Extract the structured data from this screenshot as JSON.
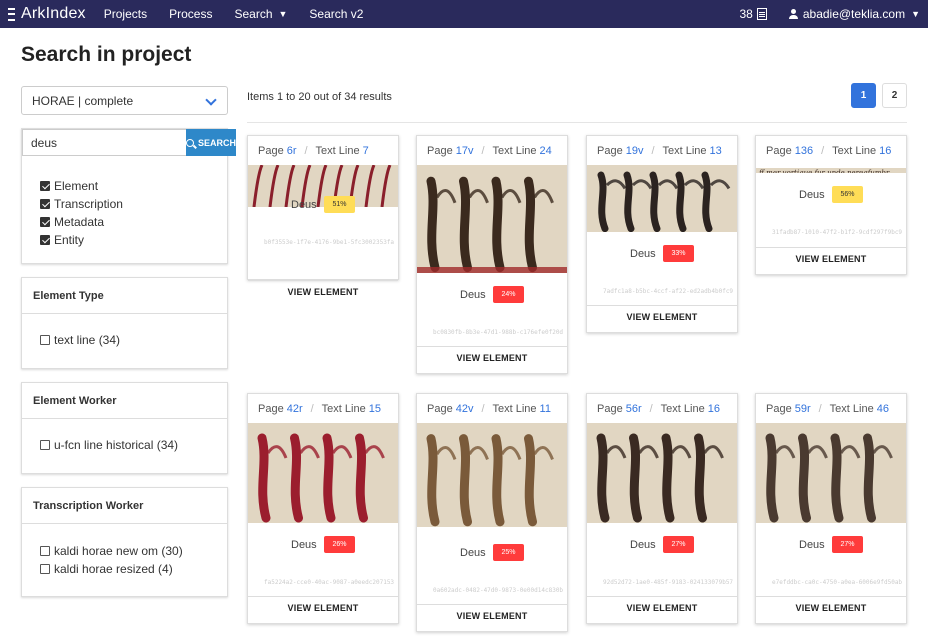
{
  "nav": {
    "logo": "ArkIndex",
    "items": [
      "Projects",
      "Process",
      "Search",
      "Search v2"
    ],
    "count": "38",
    "user": "abadie@teklia.com"
  },
  "page": {
    "title": "Search in project"
  },
  "project": {
    "selected": "HORAE | complete"
  },
  "search": {
    "query": "deus",
    "button": "SEARCH",
    "sources": [
      {
        "label": "Element",
        "checked": true
      },
      {
        "label": "Transcription",
        "checked": true
      },
      {
        "label": "Metadata",
        "checked": true
      },
      {
        "label": "Entity",
        "checked": true
      }
    ]
  },
  "facets": [
    {
      "title": "Element Type",
      "options": [
        {
          "label": "text line (34)",
          "checked": false
        }
      ]
    },
    {
      "title": "Element Worker",
      "options": [
        {
          "label": "u-fcn line historical (34)",
          "checked": false
        }
      ]
    },
    {
      "title": "Transcription Worker",
      "options": [
        {
          "label": "kaldi horae new om (30)",
          "checked": false
        },
        {
          "label": "kaldi horae resized (4)",
          "checked": false
        }
      ]
    }
  ],
  "results": {
    "summary": "Items 1 to 20 out of 34 results",
    "pages": [
      "1",
      "2"
    ],
    "active_page": "1",
    "page_prefix": "Page",
    "line_prefix": "Text Line",
    "view_label": "VIEW ELEMENT",
    "colors": {
      "high": "#ffdd57",
      "low": "#ff3b3b"
    },
    "cards": [
      {
        "page": "6r",
        "line": "7",
        "text": "Deus",
        "confidence": "51%",
        "level": "high",
        "uuid": "b0f3553e-1f7e-4176-9be1-5fc3002353fa"
      },
      {
        "page": "17v",
        "line": "24",
        "text": "Deus",
        "confidence": "24%",
        "level": "low",
        "uuid": "bc0830fb-8b3e-47d1-988b-c176efe0f20d"
      },
      {
        "page": "19v",
        "line": "13",
        "text": "Deus",
        "confidence": "33%",
        "level": "low",
        "uuid": "7adfc1a8-b5bc-4ccf-af22-ed2adb4b0fc9"
      },
      {
        "page": "136",
        "line": "16",
        "text": "Deus",
        "confidence": "56%",
        "level": "high",
        "uuid": "31fadb87-1010-47f2-b1f2-9cdf297f9bc9"
      },
      {
        "page": "42r",
        "line": "15",
        "text": "Deus",
        "confidence": "26%",
        "level": "low",
        "uuid": "fa5224a2-cce0-40ac-9087-a0eedc207153"
      },
      {
        "page": "42v",
        "line": "11",
        "text": "Deus",
        "confidence": "25%",
        "level": "low",
        "uuid": "0a602adc-0482-47d0-9873-0e00d14c830b"
      },
      {
        "page": "56r",
        "line": "16",
        "text": "Deus",
        "confidence": "27%",
        "level": "low",
        "uuid": "92d52d72-1ae0-485f-9183-024133079b57"
      },
      {
        "page": "59r",
        "line": "46",
        "text": "Deus",
        "confidence": "27%",
        "level": "low",
        "uuid": "e7efddbc-ca0c-4750-a0ea-6006e9fd50ab"
      }
    ]
  }
}
